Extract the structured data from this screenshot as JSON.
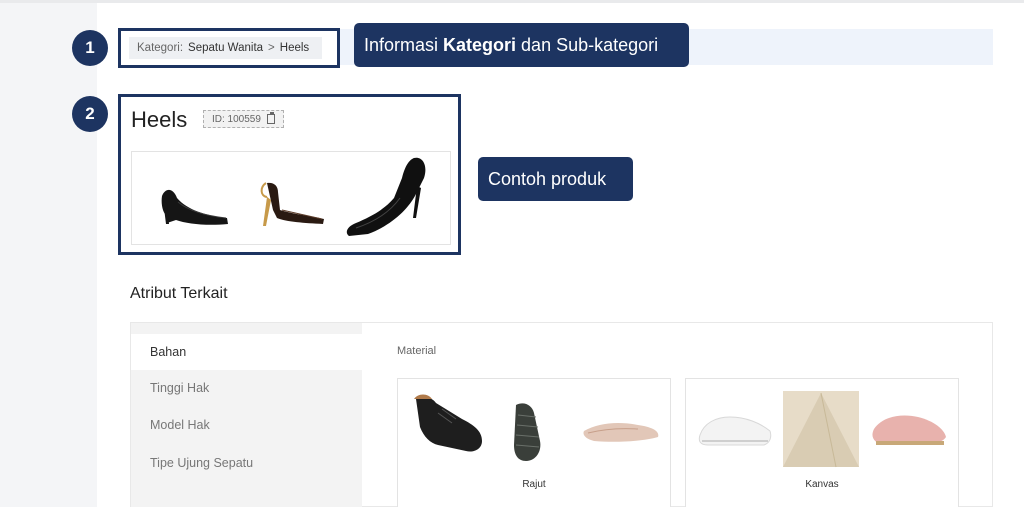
{
  "breadcrumb": {
    "prefix": "Kategori:",
    "category": "Sepatu Wanita",
    "separator": ">",
    "subcategory": "Heels"
  },
  "steps": {
    "step1": "1",
    "step2": "2"
  },
  "callouts": {
    "category_info": {
      "before": "Informasi",
      "bold": "Kategori",
      "after": "dan Sub-kategori"
    },
    "sample_products": "Contoh produk"
  },
  "category": {
    "title": "Heels",
    "id_label": "ID: 100559"
  },
  "attributes": {
    "title": "Atribut Terkait",
    "tabs": [
      "Bahan",
      "Tinggi Hak",
      "Model Hak",
      "Tipe Ujung Sepatu"
    ],
    "active_tab": "Bahan",
    "section_label": "Material",
    "materials": [
      {
        "label": "Rajut"
      },
      {
        "label": "Kanvas"
      }
    ]
  },
  "colors": {
    "navy": "#1d3461",
    "highlight": "#eef3fb"
  }
}
